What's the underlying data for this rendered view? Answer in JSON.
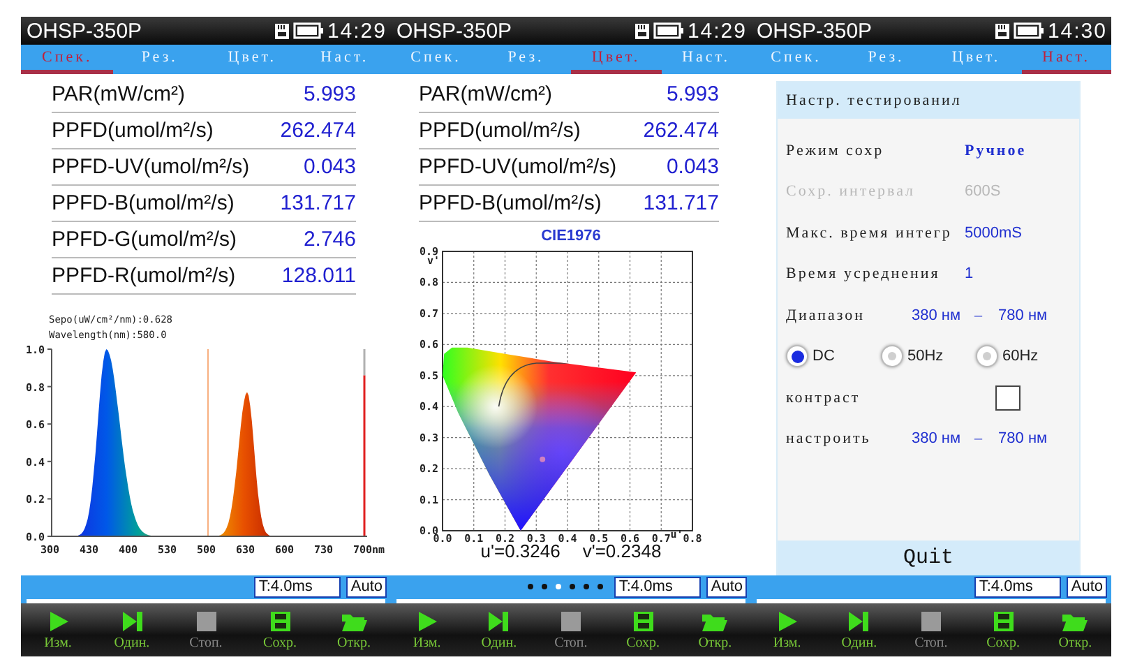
{
  "screens": [
    {
      "title": "OHSP-350P",
      "time": "14:29",
      "tabs": [
        {
          "label": "Спек.",
          "selected": true
        },
        {
          "label": "Рез.",
          "selected": false
        },
        {
          "label": "Цвет.",
          "selected": false
        },
        {
          "label": "Наст.",
          "selected": false
        }
      ],
      "readings": [
        {
          "label": "PAR(mW/cm²)",
          "value": "5.993"
        },
        {
          "label": "PPFD(umol/m²/s)",
          "value": "262.474"
        },
        {
          "label": "PPFD-UV(umol/m²/s)",
          "value": "0.043"
        },
        {
          "label": "PPFD-B(umol/m²/s)",
          "value": "131.717"
        },
        {
          "label": "PPFD-G(umol/m²/s)",
          "value": "2.746"
        },
        {
          "label": "PPFD-R(umol/m²/s)",
          "value": "128.011"
        }
      ],
      "spectrum": {
        "readouts": [
          "Sepo(uW/cm²/nm):0.628",
          "Wavelength(nm):580.0"
        ],
        "yticks": [
          "1.0",
          "0.8",
          "0.6",
          "0.4",
          "0.2",
          "0.0"
        ],
        "xticks": [
          "300",
          "430",
          "400",
          "530",
          "500",
          "630",
          "600",
          "730",
          "700nm"
        ]
      },
      "status": {
        "integration": "T:4.0ms",
        "mode": "Auto"
      },
      "toolbar": [
        {
          "kind": "play",
          "label": "Изм.",
          "disabled": false
        },
        {
          "kind": "step",
          "label": "Один.",
          "disabled": false
        },
        {
          "kind": "stop",
          "label": "Стоп.",
          "disabled": true
        },
        {
          "kind": "save",
          "label": "Сохр.",
          "disabled": false
        },
        {
          "kind": "open",
          "label": "Откр.",
          "disabled": false
        }
      ]
    },
    {
      "title": "OHSP-350P",
      "time": "14:29",
      "tabs": [
        {
          "label": "Спек.",
          "selected": false
        },
        {
          "label": "Рез.",
          "selected": false
        },
        {
          "label": "Цвет.",
          "selected": true
        },
        {
          "label": "Наст.",
          "selected": false
        }
      ],
      "readings": [
        {
          "label": "PAR(mW/cm²)",
          "value": "5.993"
        },
        {
          "label": "PPFD(umol/m²/s)",
          "value": "262.474"
        },
        {
          "label": "PPFD-UV(umol/m²/s)",
          "value": "0.043"
        },
        {
          "label": "PPFD-B(umol/m²/s)",
          "value": "131.717"
        }
      ],
      "chart_data": {
        "type": "scatter",
        "title": "CIE1976",
        "xlabel": "u'",
        "ylabel": "v'",
        "grid": true,
        "series": [
          {
            "color": "#d080c0",
            "x": [
              0.32
            ],
            "values": [
              0.23
            ]
          }
        ],
        "xlim": [
          0,
          0.8
        ],
        "ylim": [
          0,
          0.9
        ],
        "xticks": [
          {
            "value": 0,
            "label": "0.0"
          },
          {
            "value": 0.1,
            "label": "0.1"
          },
          {
            "value": 0.2,
            "label": "0.2"
          },
          {
            "value": 0.3,
            "label": "0.3"
          },
          {
            "value": 0.4,
            "label": "0.4"
          },
          {
            "value": 0.5,
            "label": "0.5"
          },
          {
            "value": 0.6,
            "label": "0.6"
          },
          {
            "value": 0.7,
            "label": "0.7"
          },
          {
            "value": 0.8,
            "label": "0.8"
          }
        ],
        "yticks": [
          {
            "value": 0,
            "label": "0.0"
          },
          {
            "value": 0.1,
            "label": "0.1"
          },
          {
            "value": 0.2,
            "label": "0.2"
          },
          {
            "value": 0.3,
            "label": "0.3"
          },
          {
            "value": 0.4,
            "label": "0.4"
          },
          {
            "value": 0.5,
            "label": "0.5"
          },
          {
            "value": 0.6,
            "label": "0.6"
          },
          {
            "value": 0.7,
            "label": "0.7"
          },
          {
            "value": 0.8,
            "label": "0.8"
          },
          {
            "value": 0.9,
            "label": "0.9"
          }
        ]
      },
      "coords": [
        "u'=0.3246",
        "v'=0.2348"
      ],
      "status": {
        "integration": "T:4.0ms",
        "mode": "Auto",
        "pager": [
          {
            "selected": false
          },
          {
            "selected": false
          },
          {
            "selected": true
          },
          {
            "selected": false
          },
          {
            "selected": false
          },
          {
            "selected": false
          }
        ]
      },
      "toolbar": [
        {
          "kind": "play",
          "label": "Изм.",
          "disabled": false
        },
        {
          "kind": "step",
          "label": "Один.",
          "disabled": false
        },
        {
          "kind": "stop",
          "label": "Стоп.",
          "disabled": true
        },
        {
          "kind": "save",
          "label": "Сохр.",
          "disabled": false
        },
        {
          "kind": "open",
          "label": "Откр.",
          "disabled": false
        }
      ]
    },
    {
      "title": "OHSP-350P",
      "time": "14:30",
      "tabs": [
        {
          "label": "Спек.",
          "selected": false
        },
        {
          "label": "Рез.",
          "selected": false
        },
        {
          "label": "Цвет.",
          "selected": false
        },
        {
          "label": "Наст.",
          "selected": true
        }
      ],
      "settings": {
        "heading": "Настр. тестированил",
        "quit": "Quit",
        "rows": [
          {
            "kind": "value",
            "label": "Режим сохр",
            "value": "Ручное",
            "disabled": false
          },
          {
            "kind": "value",
            "label": "Сохр. интервал",
            "value": "600S",
            "disabled": true
          },
          {
            "kind": "value",
            "label": "Макс. время интегр",
            "value": "5000mS",
            "disabled": false
          },
          {
            "kind": "value",
            "label": "Время усреднения",
            "value": "1",
            "disabled": false
          },
          {
            "kind": "range",
            "label": "Диапазон",
            "from": "380 нм",
            "dash": "–",
            "to": "780 нм"
          },
          {
            "kind": "radio",
            "options": [
              {
                "label": "DC",
                "selected": true
              },
              {
                "label": "50Hz",
                "selected": false
              },
              {
                "label": "60Hz",
                "selected": false
              }
            ]
          },
          {
            "kind": "checkbox",
            "label": "контраст",
            "checked": false
          },
          {
            "kind": "range",
            "label": "настроить",
            "from": "380 нм",
            "dash": "–",
            "to": "780 нм"
          }
        ]
      },
      "status": {
        "integration": "T:4.0ms",
        "mode": "Auto"
      },
      "toolbar": [
        {
          "kind": "play",
          "label": "Изм.",
          "disabled": false
        },
        {
          "kind": "step",
          "label": "Один.",
          "disabled": false
        },
        {
          "kind": "stop",
          "label": "Стоп.",
          "disabled": true
        },
        {
          "kind": "save",
          "label": "Сохр.",
          "disabled": false
        },
        {
          "kind": "open",
          "label": "Откр.",
          "disabled": false
        }
      ]
    }
  ]
}
